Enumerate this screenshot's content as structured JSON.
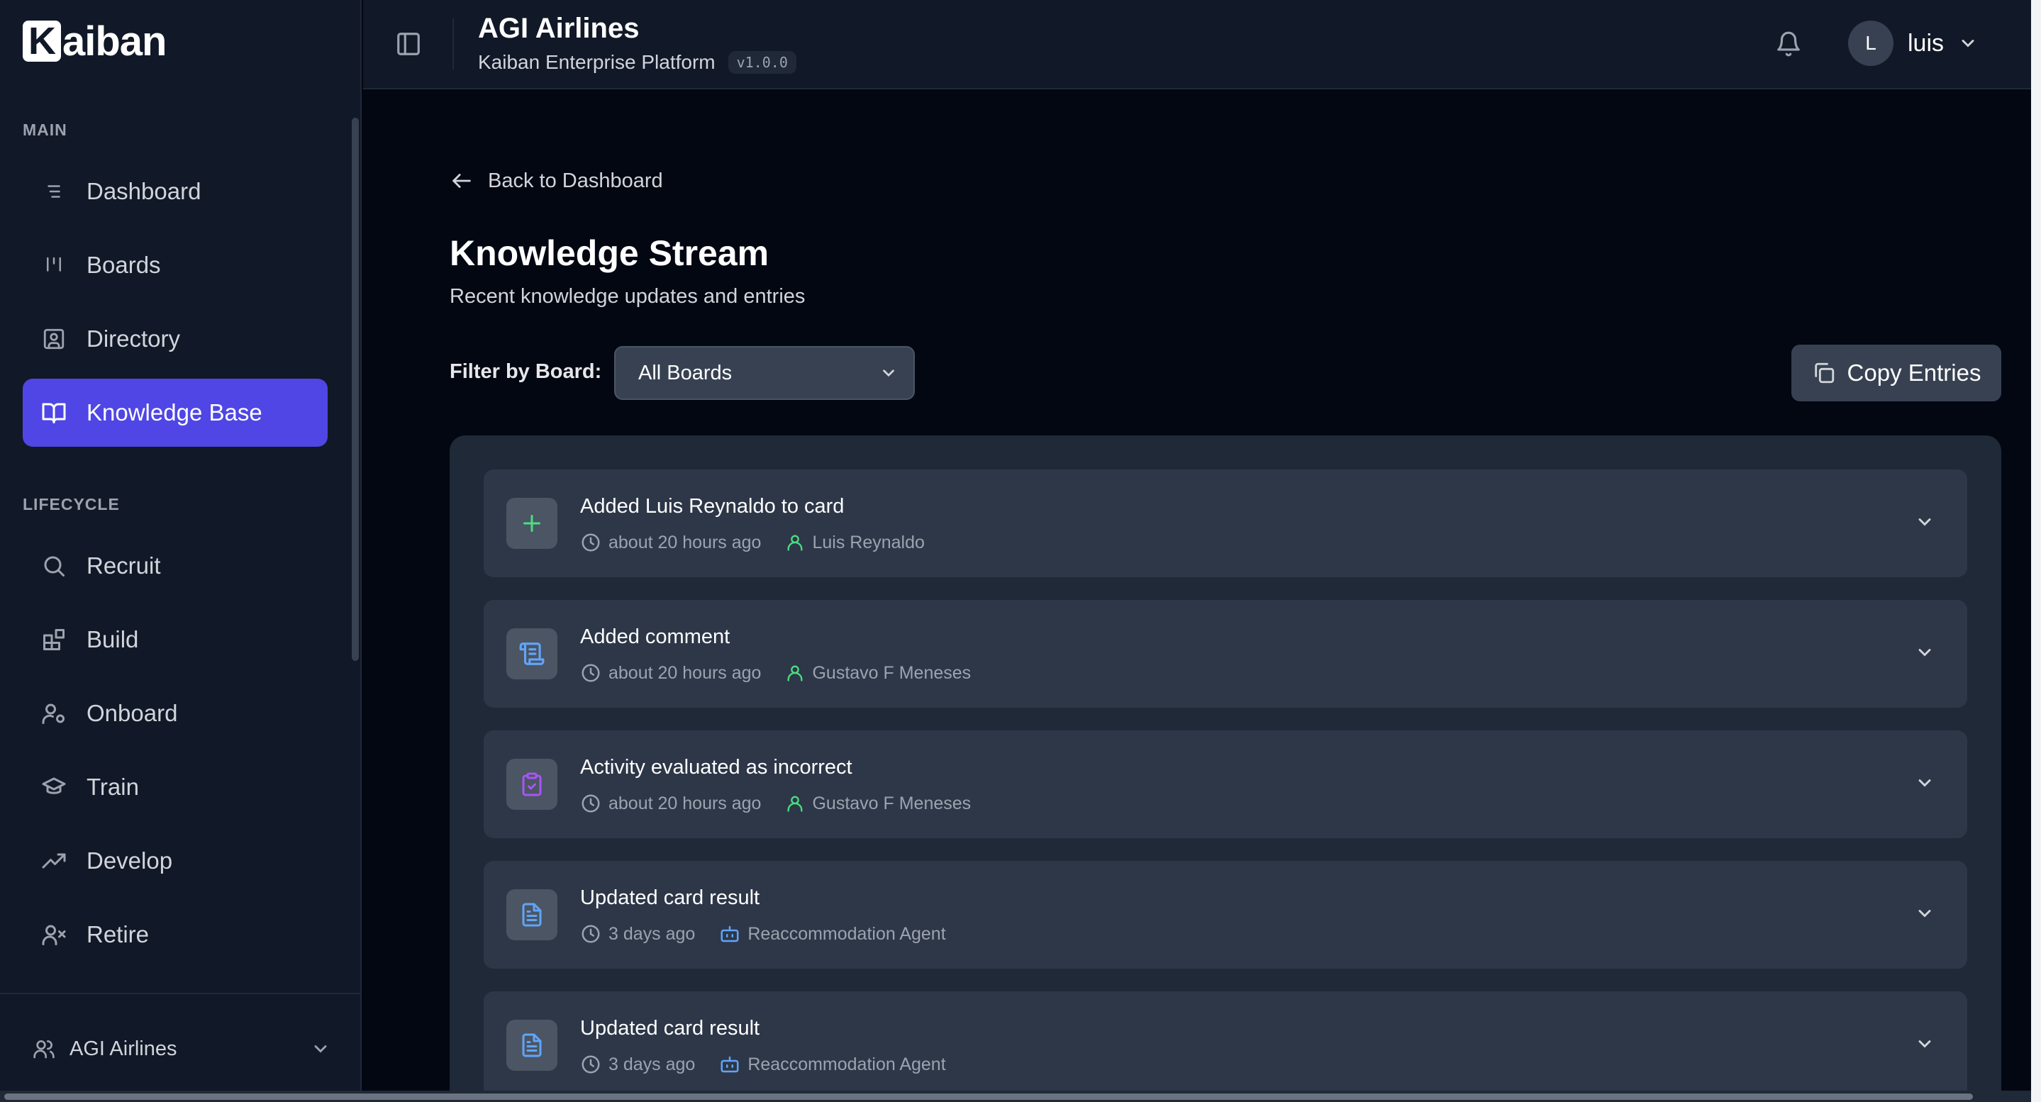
{
  "brand": {
    "logo_initial": "K",
    "logo_rest": "aiban"
  },
  "sidebar": {
    "main_label": "MAIN",
    "main_items": [
      {
        "label": "Dashboard",
        "icon": "list-icon"
      },
      {
        "label": "Boards",
        "icon": "kanban-icon"
      },
      {
        "label": "Directory",
        "icon": "contact-icon"
      },
      {
        "label": "Knowledge Base",
        "icon": "book-open-icon",
        "active": true
      }
    ],
    "lifecycle_label": "LIFECYCLE",
    "lifecycle_items": [
      {
        "label": "Recruit",
        "icon": "search-icon"
      },
      {
        "label": "Build",
        "icon": "blocks-icon"
      },
      {
        "label": "Onboard",
        "icon": "user-cog-icon"
      },
      {
        "label": "Train",
        "icon": "graduation-cap-icon"
      },
      {
        "label": "Develop",
        "icon": "trending-up-icon"
      },
      {
        "label": "Retire",
        "icon": "user-x-icon"
      }
    ],
    "org": {
      "label": "AGI Airlines",
      "icon": "users-icon"
    }
  },
  "header": {
    "title": "AGI Airlines",
    "subtitle": "Kaiban Enterprise Platform",
    "version": "v1.0.0",
    "user": {
      "initial": "L",
      "name": "luis"
    }
  },
  "main": {
    "back_label": "Back to Dashboard",
    "title": "Knowledge Stream",
    "subtitle": "Recent knowledge updates and entries",
    "filter_label": "Filter by Board:",
    "filter_value": "All Boards",
    "copy_label": "Copy Entries",
    "entries": [
      {
        "title": "Added Luis Reynaldo to card",
        "time": "about 20 hours ago",
        "author": "Luis Reynaldo",
        "icon": "plus-icon",
        "author_type": "user"
      },
      {
        "title": "Added comment",
        "time": "about 20 hours ago",
        "author": "Gustavo F Meneses",
        "icon": "scroll-icon",
        "author_type": "user"
      },
      {
        "title": "Activity evaluated as incorrect",
        "time": "about 20 hours ago",
        "author": "Gustavo F Meneses",
        "icon": "clipboard-check-icon",
        "author_type": "user"
      },
      {
        "title": "Updated card result",
        "time": "3 days ago",
        "author": "Reaccommodation Agent",
        "icon": "file-text-icon",
        "author_type": "bot"
      },
      {
        "title": "Updated card result",
        "time": "3 days ago",
        "author": "Reaccommodation Agent",
        "icon": "file-text-icon",
        "author_type": "bot"
      }
    ]
  },
  "colors": {
    "accent": "#4f46e5",
    "green": "#4ade80",
    "blue": "#60a5fa",
    "purple": "#a855f7",
    "background": "#030712",
    "panel": "#1f2937"
  }
}
